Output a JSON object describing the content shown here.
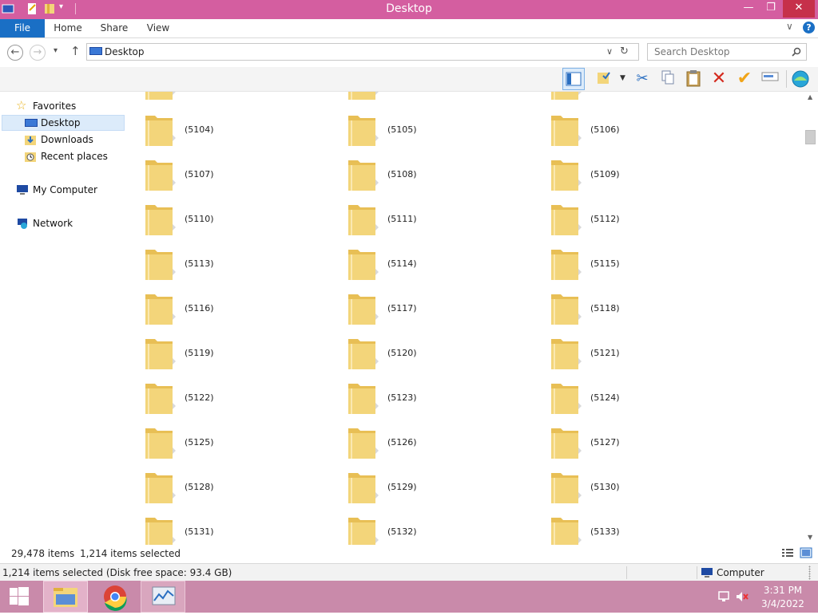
{
  "window": {
    "title": "Desktop",
    "minimize_glyph": "—",
    "restore_glyph": "❐",
    "close_glyph": "✕"
  },
  "ribbon": {
    "tabs": [
      "File",
      "Home",
      "Share",
      "View"
    ],
    "expand_glyph": "∨",
    "help_glyph": "?"
  },
  "address": {
    "location": "Desktop",
    "search_placeholder": "Search Desktop"
  },
  "toolbar": {
    "icons": [
      "preview-pane-icon",
      "folder-options-icon",
      "cut-icon",
      "copy-icon",
      "paste-icon",
      "delete-icon",
      "checkmark-icon",
      "rename-icon",
      "network-globe-icon"
    ]
  },
  "navigation": {
    "favorites_label": "Favorites",
    "favorites": [
      "Desktop",
      "Downloads",
      "Recent places"
    ],
    "selected": "Desktop",
    "my_computer": "My Computer",
    "network": "Network"
  },
  "folders": [
    "(5104)",
    "(5105)",
    "(5106)",
    "(5107)",
    "(5108)",
    "(5109)",
    "(5110)",
    "(5111)",
    "(5112)",
    "(5113)",
    "(5114)",
    "(5115)",
    "(5116)",
    "(5117)",
    "(5118)",
    "(5119)",
    "(5120)",
    "(5121)",
    "(5122)",
    "(5123)",
    "(5124)",
    "(5125)",
    "(5126)",
    "(5127)",
    "(5128)",
    "(5129)",
    "(5130)",
    "(5131)",
    "(5132)",
    "(5133)"
  ],
  "status": {
    "item_count": "29,478 items",
    "selected_count": "1,214 items selected"
  },
  "details": {
    "summary": "1,214 items selected (Disk free space: 93.4 GB)",
    "location": "Computer"
  },
  "taskbar": {
    "time": "3:31 PM",
    "date": "3/4/2022"
  },
  "colors": {
    "titlebar": "#d45ea0",
    "file_tab": "#1a6fc5",
    "taskbar": "#c98aaa",
    "folder": "#f3d57a"
  }
}
